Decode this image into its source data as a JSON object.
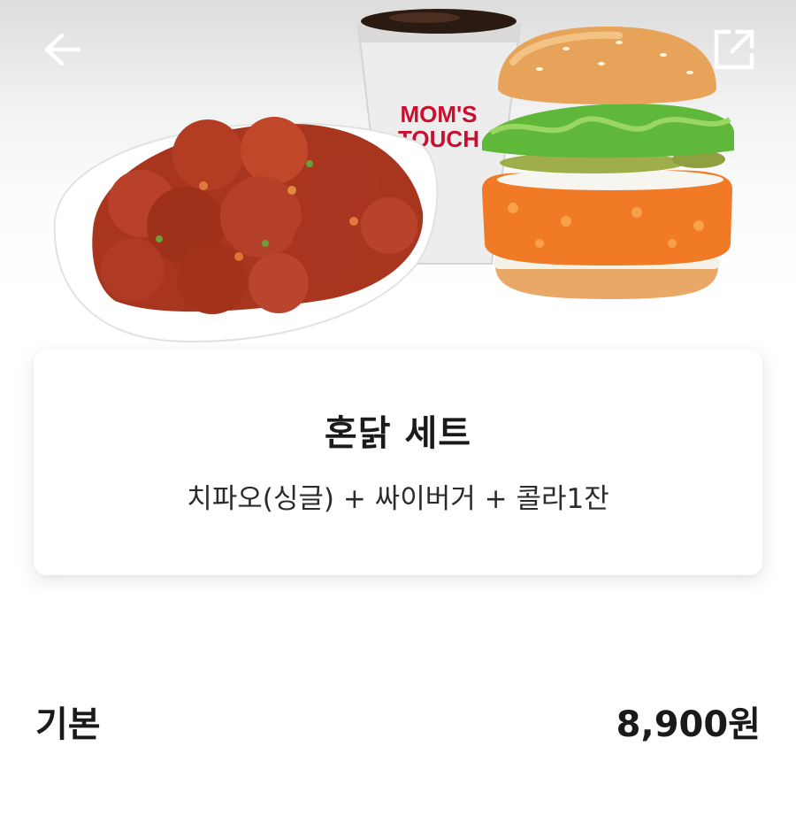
{
  "header": {
    "back_icon": "arrow-left-icon",
    "share_icon": "share-external-icon"
  },
  "hero": {
    "cup_brand_line1": "MOM'S",
    "cup_brand_line2": "TOUCH"
  },
  "product": {
    "title": "혼닭 세트",
    "description": "치파오(싱글) + 싸이버거 + 콜라1잔"
  },
  "price": {
    "label": "기본",
    "value": "8,900원"
  },
  "colors": {
    "brand_red": "#c8102e",
    "text_primary": "#1a1a1a"
  }
}
